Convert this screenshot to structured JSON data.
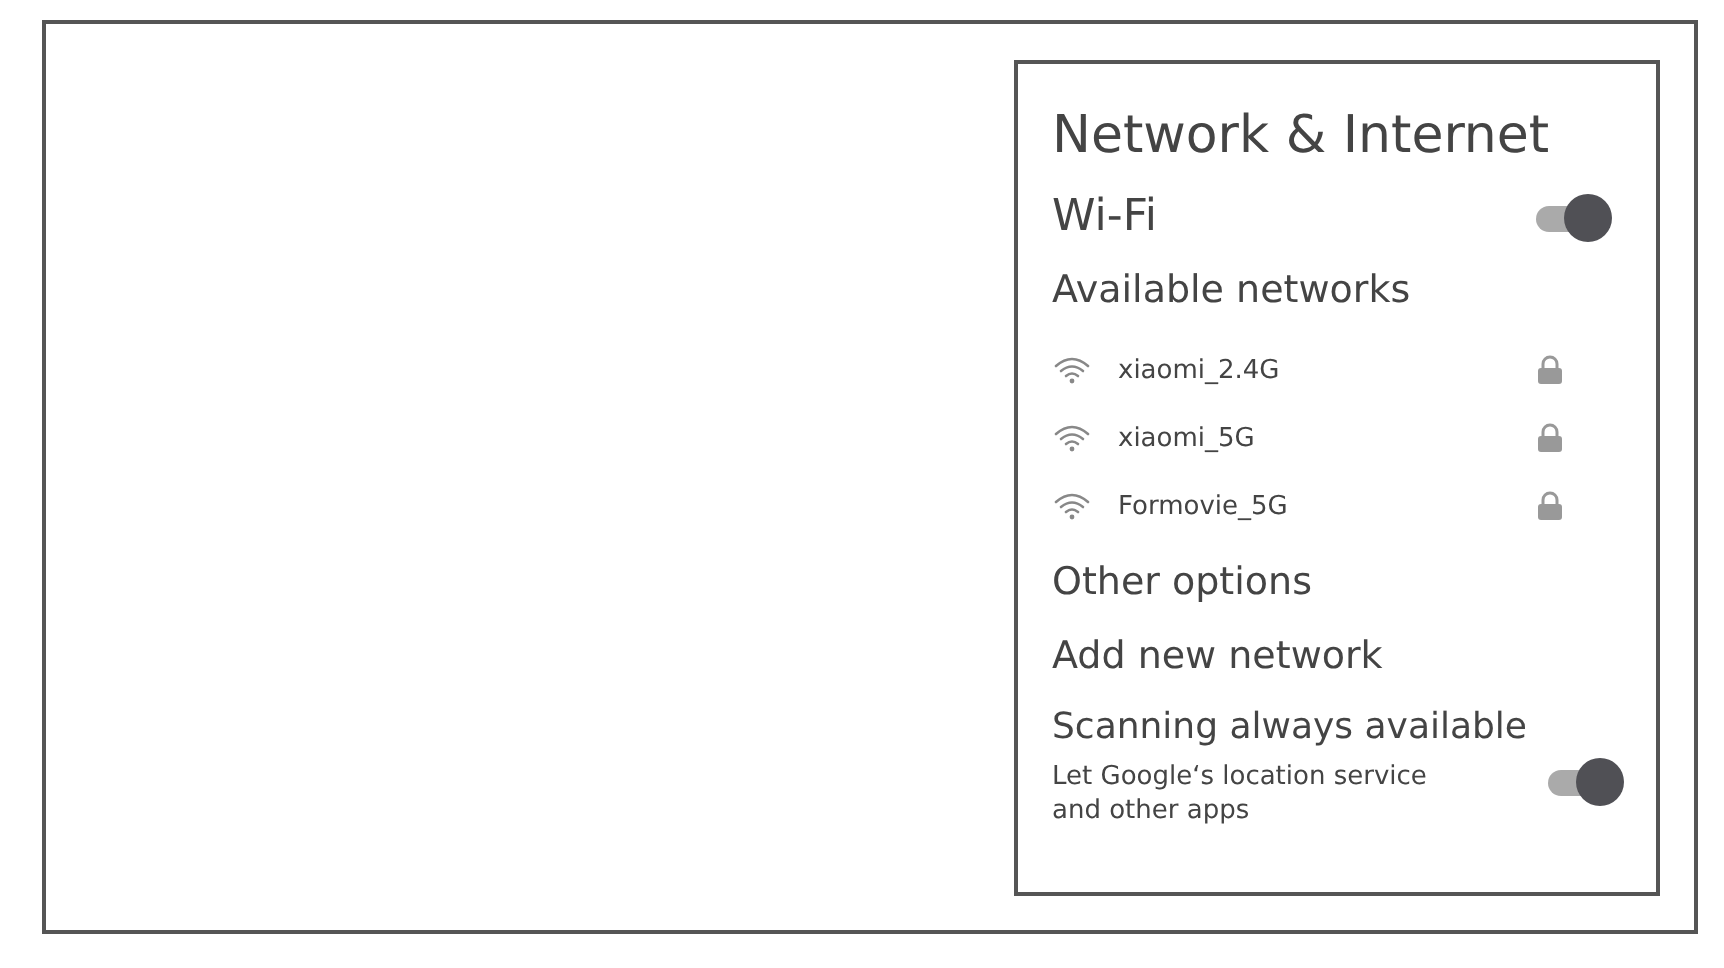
{
  "panel": {
    "title": "Network & Internet",
    "wifi": {
      "label": "Wi-Fi",
      "on": true
    },
    "available_heading": "Available networks",
    "networks": [
      {
        "name": "xiaomi_2.4G",
        "locked": true
      },
      {
        "name": "xiaomi_5G",
        "locked": true
      },
      {
        "name": "Formovie_5G",
        "locked": true
      }
    ],
    "other_heading": "Other options",
    "add_network": "Add new network",
    "scanning": {
      "label": "Scanning always available",
      "description": "Let Google‘s location service and other apps",
      "on": true
    }
  }
}
